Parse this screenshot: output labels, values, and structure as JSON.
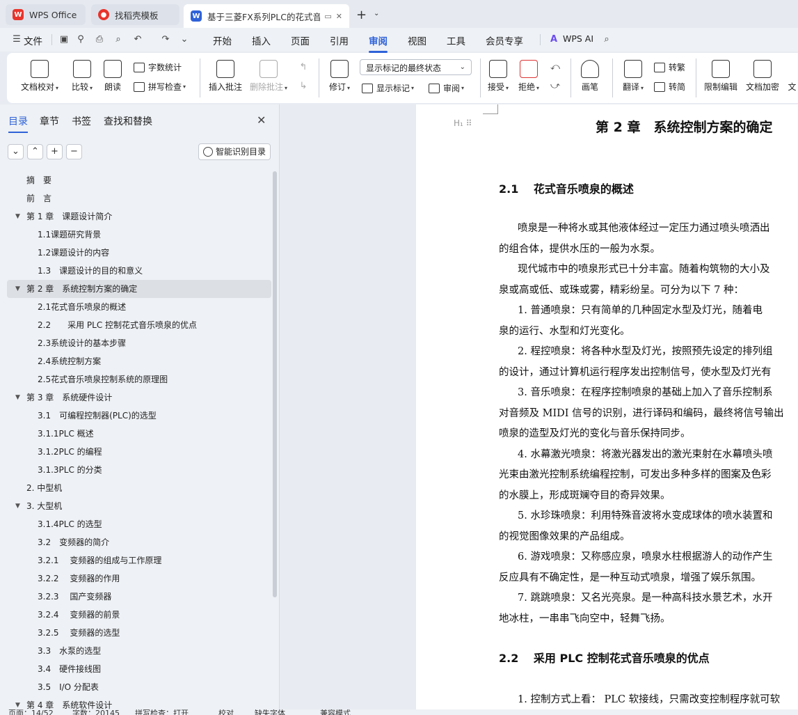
{
  "tabs": {
    "wps": "WPS Office",
    "template": "找稻壳模板",
    "doc": "基于三菱FX系列PLC的花式音乐喷泉控制系统设计"
  },
  "menu": [
    "开始",
    "插入",
    "页面",
    "引用",
    "审阅",
    "视图",
    "工具",
    "会员专享"
  ],
  "menu_file": "文件",
  "menu_ai": "WPS AI",
  "ribbon": {
    "doc_check": "文档校对",
    "compare": "比较",
    "read_aloud": "朗读",
    "word_count": "字数统计",
    "spell_check": "拼写检查",
    "insert_comment": "插入批注",
    "delete_comment": "删除批注",
    "revise": "修订",
    "markup_state": "显示标记的最终状态",
    "show_markup": "显示标记",
    "review": "审阅",
    "accept": "接受",
    "reject": "拒绝",
    "pen": "画笔",
    "translate": "翻译",
    "to_traditional": "转繁",
    "to_simplified": "转简",
    "restrict_edit": "限制编辑",
    "doc_encrypt": "文档加密",
    "doc_more": "文"
  },
  "nav": {
    "tabs": [
      "目录",
      "章节",
      "书签",
      "查找和替换"
    ],
    "smart_toc": "智能识别目录",
    "toc": [
      {
        "text": "摘　要",
        "level": 1,
        "toggle": ""
      },
      {
        "text": "前　言",
        "level": 1,
        "toggle": ""
      },
      {
        "text": "第 1 章　课题设计简介",
        "level": 1,
        "toggle": "▼"
      },
      {
        "text": "1.1课题研究背景",
        "level": 2,
        "toggle": ""
      },
      {
        "text": "1.2课题设计的内容",
        "level": 2,
        "toggle": ""
      },
      {
        "text": "1.3　课题设计的目的和意义",
        "level": 2,
        "toggle": ""
      },
      {
        "text": "第 2 章　系统控制方案的确定",
        "level": 1,
        "toggle": "▼",
        "selected": true
      },
      {
        "text": "2.1花式音乐喷泉的概述",
        "level": 2,
        "toggle": ""
      },
      {
        "text": "2.2　　采用 PLC 控制花式音乐喷泉的优点",
        "level": 2,
        "toggle": ""
      },
      {
        "text": "2.3系统设计的基本步骤",
        "level": 2,
        "toggle": ""
      },
      {
        "text": "2.4系统控制方案",
        "level": 2,
        "toggle": ""
      },
      {
        "text": "2.5花式音乐喷泉控制系统的原理图",
        "level": 2,
        "toggle": ""
      },
      {
        "text": "第 3 章　系统硬件设计",
        "level": 1,
        "toggle": "▼"
      },
      {
        "text": "3.1　可编程控制器(PLC)的选型",
        "level": 2,
        "toggle": ""
      },
      {
        "text": "3.1.1PLC 概述",
        "level": 2,
        "toggle": ""
      },
      {
        "text": "3.1.2PLC 的编程",
        "level": 2,
        "toggle": ""
      },
      {
        "text": "3.1.3PLC 的分类",
        "level": 2,
        "toggle": ""
      },
      {
        "text": "2. 中型机",
        "level": 1,
        "toggle": ""
      },
      {
        "text": "3. 大型机",
        "level": 1,
        "toggle": "▼"
      },
      {
        "text": "3.1.4PLC 的选型",
        "level": 2,
        "toggle": ""
      },
      {
        "text": "3.2　变频器的简介",
        "level": 2,
        "toggle": ""
      },
      {
        "text": "3.2.1　 变频器的组成与工作原理",
        "level": 2,
        "toggle": ""
      },
      {
        "text": "3.2.2　 变频器的作用",
        "level": 2,
        "toggle": ""
      },
      {
        "text": "3.2.3　 国产变频器",
        "level": 2,
        "toggle": ""
      },
      {
        "text": "3.2.4　 变频器的前景",
        "level": 2,
        "toggle": ""
      },
      {
        "text": "3.2.5　 变频器的选型",
        "level": 2,
        "toggle": ""
      },
      {
        "text": "3.3　水泵的选型",
        "level": 2,
        "toggle": ""
      },
      {
        "text": "3.4　硬件接线图",
        "level": 2,
        "toggle": ""
      },
      {
        "text": "3.5　I/O 分配表",
        "level": 2,
        "toggle": ""
      },
      {
        "text": "第 4 章　系统软件设计",
        "level": 1,
        "toggle": "▼"
      }
    ]
  },
  "doc": {
    "chapter_title": "第 2 章　系统控制方案的确定",
    "sec1": "2.1　 花式音乐喷泉的概述",
    "lines": [
      {
        "t": "喷泉是一种将水或其他液体经过一定压力通过喷头喷洒出",
        "ind": true
      },
      {
        "t": "的组合体，提供水压的一般为水泵。",
        "ind": false
      },
      {
        "t": "现代城市中的喷泉形式已十分丰富。随着构筑物的大小及",
        "ind": true
      },
      {
        "t": "泉或高或低、或珠或雾，精彩纷呈。可分为以下 7 种：",
        "ind": false
      },
      {
        "t": "1.  普通喷泉：只有简单的几种固定水型及灯光，随着电",
        "ind": true
      },
      {
        "t": "泉的运行、水型和灯光变化。",
        "ind": false
      },
      {
        "t": "2.  程控喷泉：将各种水型及灯光，按照预先设定的排列组",
        "ind": true
      },
      {
        "t": "的设计，通过计算机运行程序发出控制信号，使水型及灯光有",
        "ind": false
      },
      {
        "t": "3.  音乐喷泉：在程序控制喷泉的基础上加入了音乐控制系",
        "ind": true
      },
      {
        "t": "对音频及 MIDI 信号的识别，进行译码和编码，最终将信号输出",
        "ind": false
      },
      {
        "t": "喷泉的造型及灯光的变化与音乐保持同步。",
        "ind": false
      },
      {
        "t": "4.  水幕激光喷泉：将激光器发出的激光束射在水幕喷头喷",
        "ind": true
      },
      {
        "t": "光束由激光控制系统编程控制，可发出多种多样的图案及色彩",
        "ind": false
      },
      {
        "t": "的水膜上，形成斑斓夺目的奇异效果。",
        "ind": false
      },
      {
        "t": "5.  水珍珠喷泉：利用特殊音波将水变成球体的喷水装置和",
        "ind": true
      },
      {
        "t": "的视觉图像效果的产品组成。",
        "ind": false
      },
      {
        "t": "6.  游戏喷泉：又称感应泉，喷泉水柱根据游人的动作产生",
        "ind": true
      },
      {
        "t": "反应具有不确定性，是一种互动式喷泉，增强了娱乐氛围。",
        "ind": false
      },
      {
        "t": "7.  跳跳喷泉：又名光亮泉。是一种高科技水景艺术，水开",
        "ind": true
      },
      {
        "t": "地冰柱，一串串飞向空中，轻舞飞扬。",
        "ind": false
      }
    ],
    "sec2": "2.2　 采用 PLC 控制花式音乐喷泉的优点",
    "last_line": "1.  控制方式上看：  PLC 软接线，只需改变控制程序就可软"
  },
  "status": {
    "page": "页面：14/52",
    "words": "字数：20145",
    "spell": "拼写检查：打开",
    "proof": "校对",
    "missing_font": "缺失字体",
    "compat": "兼容模式"
  }
}
